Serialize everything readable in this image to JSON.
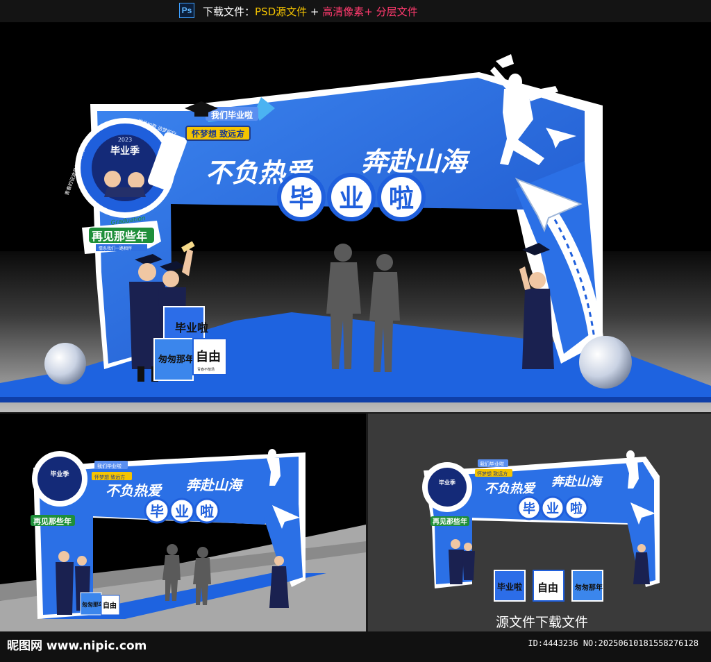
{
  "header": {
    "ps_label": "Ps",
    "text_download": "下载文件：",
    "text_psd": "PSD源文件",
    "plus1": "+",
    "text_hd": "高清像素+",
    "text_layers": "分层文件"
  },
  "arch": {
    "slogan_left": "不负热爱",
    "slogan_right": "奔赴山海",
    "title_chars": [
      "毕",
      "业",
      "啦"
    ],
    "tag_grad": "我们毕业啦",
    "tag_dream": "怀梦想 致远方",
    "badge_label": "毕业季",
    "badge_year": "2023",
    "badge_ring_text": "青春的征途是星辰大海",
    "badge_top_text": "岁月如歌 追梦前行",
    "farewell_script": "Graduation",
    "farewell_main": "再见那些年",
    "farewell_sub": "情系我们一路相伴"
  },
  "boxes": {
    "box_a": "毕业啦",
    "box_b": "匆匆那年",
    "box_c": "自由",
    "box_c_sub": "青春不散场"
  },
  "caption": "源文件下载文件",
  "footer": {
    "brand": "昵图网 www.nipic.com",
    "id": "ID:4443236 NO:20250610181558276128"
  },
  "colors": {
    "brand_blue": "#1f5fdc",
    "light_blue": "#3d86f0",
    "arch_white": "#ffffff",
    "navy": "#142a78",
    "floor_blue": "#1e63e0",
    "green": "#1f8f3a",
    "accent_yellow": "#f5c400",
    "accent_pink": "#ff3a6e"
  }
}
